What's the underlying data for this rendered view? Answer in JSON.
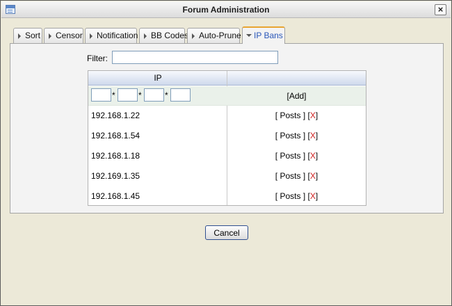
{
  "window": {
    "title": "Forum Administration",
    "close_glyph": "×"
  },
  "tabs": [
    {
      "label": "Sort",
      "active": false
    },
    {
      "label": "Censor",
      "active": false
    },
    {
      "label": "Notification",
      "active": false
    },
    {
      "label": "BB Codes",
      "active": false
    },
    {
      "label": "Auto-Prune",
      "active": false
    },
    {
      "label": "IP Bans",
      "active": true
    }
  ],
  "filter": {
    "label": "Filter:",
    "value": ""
  },
  "grid": {
    "columns": [
      "IP",
      ""
    ],
    "add_row": {
      "separator": "*",
      "add_label": "[Add]"
    },
    "rows": [
      {
        "ip": "192.168.1.22"
      },
      {
        "ip": "192.168.1.54"
      },
      {
        "ip": "192.168.1.18"
      },
      {
        "ip": "192.169.1.35"
      },
      {
        "ip": "192.168.1.45"
      }
    ],
    "row_actions": {
      "open": "[",
      "posts": "Posts",
      "close": "]",
      "x": "X"
    }
  },
  "buttons": {
    "cancel": "Cancel"
  },
  "colors": {
    "active_tab_text": "#2a57b8",
    "active_tab_top": "#e8a430",
    "delete_x": "#d02020"
  }
}
